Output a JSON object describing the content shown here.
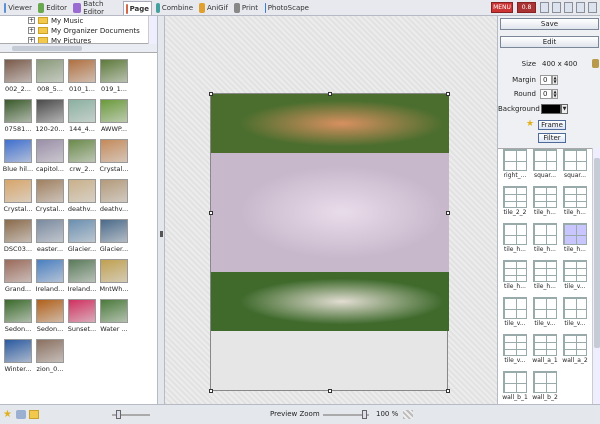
{
  "tabs": [
    {
      "label": "Viewer",
      "icon": "viewer-icon",
      "color": "#5b8fd6"
    },
    {
      "label": "Editor",
      "icon": "editor-icon",
      "color": "#6aa84f"
    },
    {
      "label": "Batch Editor",
      "icon": "batch-editor-icon",
      "color": "#9b6bd1"
    },
    {
      "label": "Page",
      "icon": "page-icon",
      "color": "#d1684b"
    },
    {
      "label": "Combine",
      "icon": "combine-icon",
      "color": "#46a0a0"
    },
    {
      "label": "AniGif",
      "icon": "anigif-icon",
      "color": "#e0a030"
    },
    {
      "label": "Print",
      "icon": "print-icon",
      "color": "#888"
    },
    {
      "label": "PhotoScape",
      "icon": "photoscape-icon",
      "color": "#3a7bd5"
    }
  ],
  "toolbar_right": {
    "menu_label": "MENU",
    "size_label": "0.8",
    "tools": [
      "help-icon",
      "settings-icon",
      "folder-icon",
      "info-icon",
      "window-icon"
    ]
  },
  "tree": [
    {
      "label": "My Music"
    },
    {
      "label": "My Organizer Documents"
    },
    {
      "label": "My Pictures"
    }
  ],
  "thumbnails": [
    {
      "label": "002_2...",
      "color": "#7a5a4a"
    },
    {
      "label": "008_5...",
      "color": "#8a9a7a"
    },
    {
      "label": "010_1...",
      "color": "#b07040"
    },
    {
      "label": "019_1...",
      "color": "#5d7a3a"
    },
    {
      "label": "07581...",
      "color": "#3a5a2a"
    },
    {
      "label": "120-20...",
      "color": "#4a4a4a"
    },
    {
      "label": "144_4...",
      "color": "#8ab0a0"
    },
    {
      "label": "AWWP...",
      "color": "#6a9a3a"
    },
    {
      "label": "Blue hil...",
      "color": "#3f6fcf"
    },
    {
      "label": "capitol...",
      "color": "#9a8fa8"
    },
    {
      "label": "crw_2...",
      "color": "#6a8a4a"
    },
    {
      "label": "Crystal...",
      "color": "#c48a5a"
    },
    {
      "label": "Crystal...",
      "color": "#d7a56a"
    },
    {
      "label": "Crystal...",
      "color": "#a08060"
    },
    {
      "label": "deathv...",
      "color": "#c9b08a"
    },
    {
      "label": "deathv...",
      "color": "#b39a7a"
    },
    {
      "label": "DSC03...",
      "color": "#8a6a4a"
    },
    {
      "label": "easter...",
      "color": "#7a8aa0"
    },
    {
      "label": "Glacier...",
      "color": "#6a8fb0"
    },
    {
      "label": "Glacier...",
      "color": "#4a6a8a"
    },
    {
      "label": "Grand...",
      "color": "#9a6a5a"
    },
    {
      "label": "Ireland...",
      "color": "#4a7fc0"
    },
    {
      "label": "Ireland...",
      "color": "#5a7a5a"
    },
    {
      "label": "MntWh...",
      "color": "#c0a050"
    },
    {
      "label": "Sedon...",
      "color": "#3a6a2a"
    },
    {
      "label": "Sedon...",
      "color": "#b0601a"
    },
    {
      "label": "Sunset...",
      "color": "#d03060"
    },
    {
      "label": "Water ...",
      "color": "#4a7a3a"
    },
    {
      "label": "Winter...",
      "color": "#2a5aa0"
    },
    {
      "label": "zion_0...",
      "color": "#8a7060"
    }
  ],
  "canvas": {
    "photos": [
      {
        "name": "girl-face-paint",
        "color": "#4b6e2e",
        "accent": "#d89060"
      },
      {
        "name": "magnolia-blossoms",
        "color": "#c8b8cc",
        "accent": "#e9dcea"
      },
      {
        "name": "goats-on-rocks",
        "color": "#3f6a2c",
        "accent": "#e2ddd2"
      }
    ]
  },
  "right_panel": {
    "save_label": "Save",
    "edit_label": "Edit",
    "size_label": "Size",
    "size_value": "400 x 400",
    "margin_label": "Margin",
    "margin_value": "0",
    "round_label": "Round",
    "round_value": "0",
    "background_label": "Background",
    "background_color": "#000000",
    "frame_label": "Frame",
    "filter_label": "Filter"
  },
  "templates": [
    {
      "name": "right_..."
    },
    {
      "name": "squar..."
    },
    {
      "name": "squar..."
    },
    {
      "name": "tile_2_2"
    },
    {
      "name": "tile_h..."
    },
    {
      "name": "tile_h..."
    },
    {
      "name": "tile_h..."
    },
    {
      "name": "tile_h..."
    },
    {
      "name": "tile_h...",
      "selected": true
    },
    {
      "name": "tile_h..."
    },
    {
      "name": "tile_h..."
    },
    {
      "name": "tile_v..."
    },
    {
      "name": "tile_v..."
    },
    {
      "name": "tile_v..."
    },
    {
      "name": "tile_v..."
    },
    {
      "name": "tile_v..."
    },
    {
      "name": "wall_a_1"
    },
    {
      "name": "wall_a_2"
    },
    {
      "name": "wall_b_1"
    },
    {
      "name": "wall_b_2"
    }
  ],
  "status": {
    "preview_zoom_label": "Preview Zoom",
    "zoom_value": "100 %"
  }
}
